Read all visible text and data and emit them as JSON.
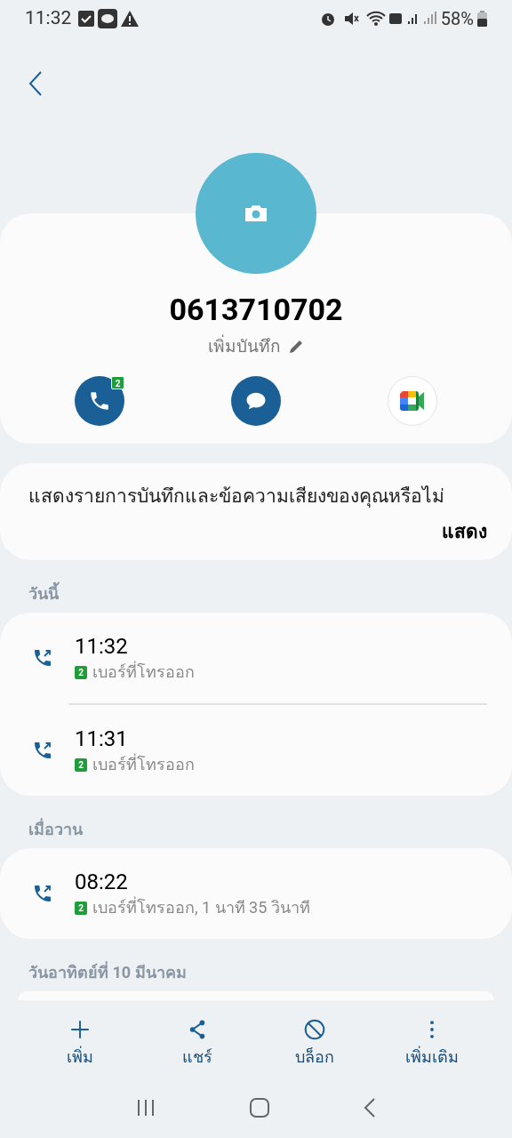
{
  "status_bar": {
    "time": "11:32",
    "battery": "58%"
  },
  "contact": {
    "number": "0613710702",
    "note": "เพิ่มบันทึก"
  },
  "actions": [
    {
      "kind": "call",
      "badge": "2"
    },
    {
      "kind": "message"
    },
    {
      "kind": "video"
    }
  ],
  "prompt": {
    "text": "แสดงรายการบันทึกและข้อความเสียงของคุณหรือไม่",
    "button": "แสดง"
  },
  "sections": [
    {
      "heading": "วันนี้",
      "calls": [
        {
          "time": "11:32",
          "sim": "2",
          "detail": "เบอร์ที่โทรออก"
        },
        {
          "time": "11:31",
          "sim": "2",
          "detail": "เบอร์ที่โทรออก"
        }
      ]
    },
    {
      "heading": "เมื่อวาน",
      "calls": [
        {
          "time": "08:22",
          "sim": "2",
          "detail": "เบอร์ที่โทรออก, 1 นาที 35 วินาที"
        }
      ]
    },
    {
      "heading": "วันอาทิตย์ที่ 10 มีนาคม"
    }
  ],
  "bottom_bar": [
    {
      "kind": "add",
      "label": "เพิ่ม"
    },
    {
      "kind": "share",
      "label": "แชร์"
    },
    {
      "kind": "block",
      "label": "บล็อก"
    },
    {
      "kind": "more",
      "label": "เพิ่มเติม"
    }
  ]
}
